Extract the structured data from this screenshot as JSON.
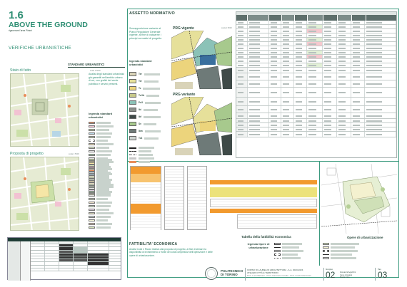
{
  "project": {
    "number": "1.6",
    "title": "ABOVE THE GROUND",
    "subtitle": "rigenerare l'area Pirisei"
  },
  "left": {
    "section_title": "VERIFICHE URBANISTICHE",
    "standards_title": "STANDARD URBANISTICI",
    "stato_title": "Stato di fatto",
    "stato_note": "Analisi degli standard urbanistici già garantiti nell'ambito urbano di cui, con grafici del verde pubblico e servizi presenti.",
    "stato_scale": "scala 1:5000",
    "legend_title": "legenda standard urbanistici",
    "proposta_title": "Proposta di progetto",
    "proposta_scale": "scala 1:5000"
  },
  "assetto": {
    "title": "ASSETTO NORMATIVO",
    "note": "Sovrapposizione variante al Piano Regolatore Generale vigente, al fine di valutarne i principi normativi di progetto.",
    "prg_vigente": "PRG vigente",
    "prg_variante": "PRG variante",
    "legend_title": "legenda standard urbanistici",
    "legend_codes": [
      "Ter",
      "Ter",
      "Tc",
      "Tc+Ib",
      "Pu3",
      "Ibi",
      "Ibf",
      "Sv",
      "Ibm",
      "Tc3"
    ],
    "scale": "scala 1:5000"
  },
  "fattibilita": {
    "title": "FATTIBILITA' ECONOMICA",
    "note": "Analisi Costi e Ricavi relativa alla proposta di progetto, al fine di stimare la disponibilità di investimento a fronte dei costi complessivi dell'operazione e delle opere di urbanizzazione.",
    "table_title": "Tabella della fattibilità economica",
    "legend_title": "legenda Opere di urbanizzazione"
  },
  "opere": {
    "title": "Opere di urbanizzazione"
  },
  "footer": {
    "university_line1": "POLITECNICO",
    "university_line2": "DI TORINO",
    "course_line1": "CORSO DI LAUREA IN ARCHITETTURA - A.A. 2023-2024",
    "course_line2": "ATELIER CITTÀ E TERRITORIO",
    "professors": "Prof. Luca Barbieri - Prof. Giancarlo Cotella - Prof. Guido Montanari",
    "group_label": "Gruppo",
    "group_number": "02",
    "students": [
      "Giovanni Agazzini",
      "Irene Amateis",
      "Marta Cirio"
    ],
    "table_label": "Tav.",
    "table_number": "03"
  },
  "colors": {
    "accent": "#2f8f74",
    "frame": "#3a9a7e",
    "orange": "#f29a2e",
    "yellow": "#ece27a",
    "map_green": "#dfe6c9"
  }
}
